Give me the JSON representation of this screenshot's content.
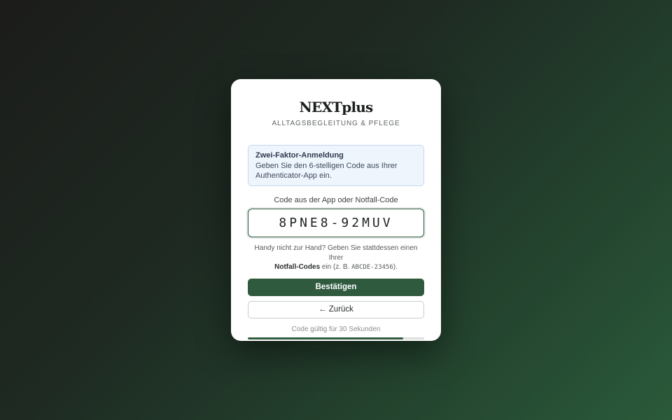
{
  "brand": {
    "name": "NEXTplus",
    "tagline": "ALLTAGSBEGLEITUNG & PFLEGE"
  },
  "info_box": {
    "title": "Zwei-Faktor-Anmeldung",
    "text": "Geben Sie den 6-stelligen Code aus Ihrer Authenticator-App ein."
  },
  "code_field": {
    "label": "Code aus der App oder Notfall-Code",
    "value": "8PNE8-92MUV"
  },
  "hint": {
    "prefix": "Handy nicht zur Hand? Geben Sie stattdessen einen Ihrer",
    "bold": "Notfall-Codes",
    "middle": " ein (z. B. ",
    "example": "ABCDE-23456",
    "suffix": ")."
  },
  "buttons": {
    "confirm_label": "Bestätigen",
    "back_label": "← Zurück"
  },
  "validity": {
    "text": "Code gültig für 30 Sekunden",
    "progress_fraction": 0.88
  },
  "colors": {
    "accent": "#2f5a3e",
    "info_background": "#eef5fd",
    "info_border": "#c4d9f0"
  }
}
